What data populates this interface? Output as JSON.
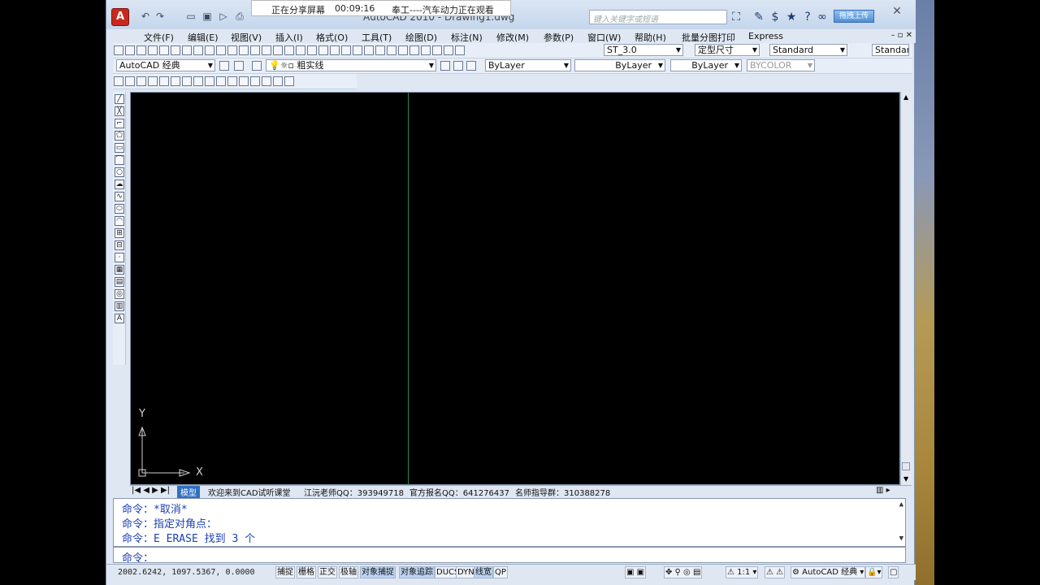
{
  "share_bar": {
    "status": "正在分享屏幕",
    "timer": "00:09:16",
    "viewer": "奉工----汽车动力正在观看"
  },
  "title": "AutoCAD 2010 - Drawing1.dwg",
  "search": {
    "placeholder": "键入关键字或短语"
  },
  "upload_label": "拖拽上传",
  "menu": [
    "文件(F)",
    "编辑(E)",
    "视图(V)",
    "插入(I)",
    "格式(O)",
    "工具(T)",
    "绘图(D)",
    "标注(N)",
    "修改(M)",
    "参数(P)",
    "窗口(W)",
    "帮助(H)",
    "批量分图打印",
    "Express"
  ],
  "toolbars": {
    "text_style": "ST_3.0",
    "dim_style": "定型尺寸",
    "table_style": "Standard",
    "ml_style": "Standar",
    "workspace": "AutoCAD 经典",
    "layer": "粗实线",
    "color": "ByLayer",
    "linetype": "ByLayer",
    "lineweight": "ByLayer",
    "plotstyle": "BYCOLOR"
  },
  "canvas": {
    "ucs_x": "X",
    "ucs_y": "Y"
  },
  "tabs": [
    "模型",
    "欢迎来到CAD试听课堂",
    "江沅老师QQ：393949718",
    "官方报名QQ：641276437",
    "名师指导群：310388278"
  ],
  "command": {
    "lines": [
      "命令：*取消*",
      "命令：指定对角点：",
      "命令：E ERASE 找到 3 个"
    ],
    "prompt": "命令："
  },
  "status": {
    "coords": "2002.6242, 1097.5367, 0.0000",
    "buttons": [
      "捕捉",
      "栅格",
      "正交",
      "极轴",
      "对象捕捉",
      "对象追踪",
      "DUCS",
      "DYN",
      "线宽",
      "QP"
    ],
    "annotation_scale": "1:1",
    "workspace": "AutoCAD 经典"
  },
  "colors": {
    "canvas": "#000000",
    "command_text": "#1a3fb5",
    "active_tab": "#2d6fc5"
  }
}
